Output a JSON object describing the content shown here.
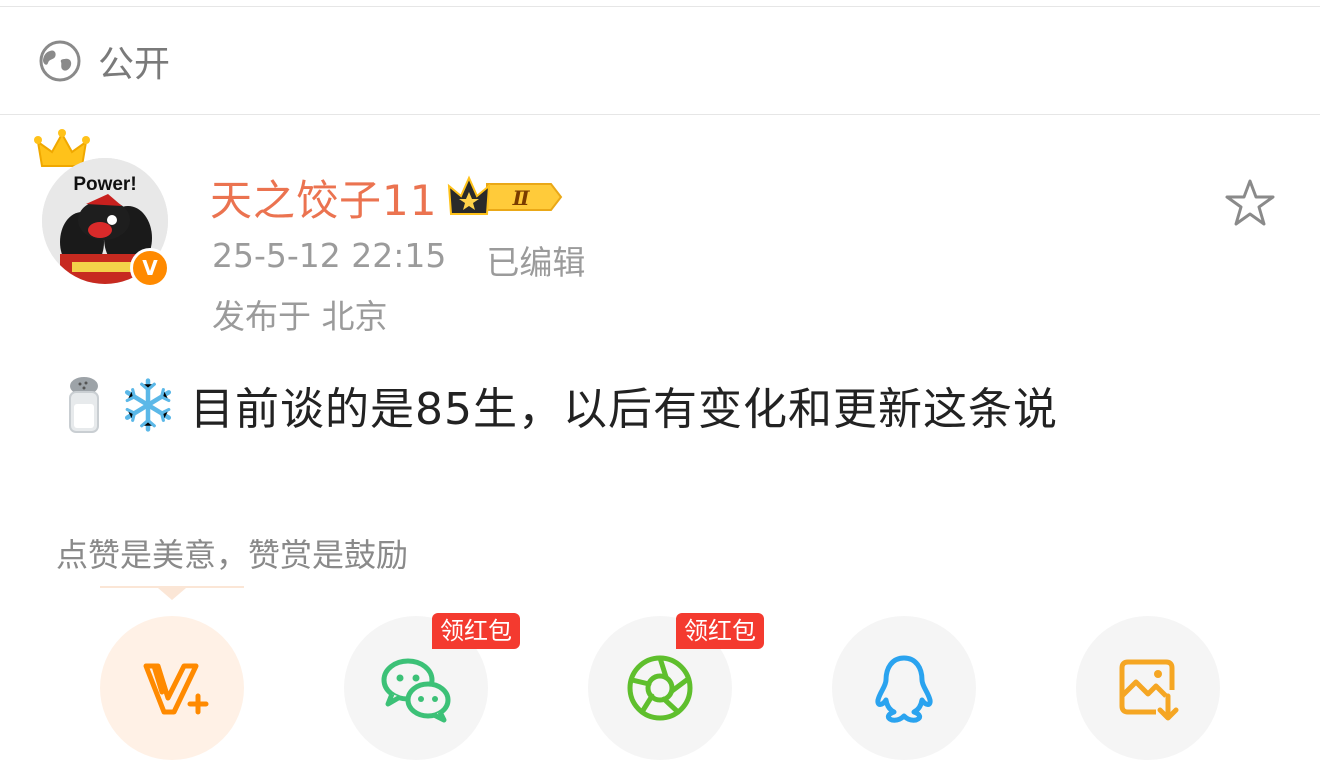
{
  "visibility": {
    "label": "公开",
    "icon": "globe-icon"
  },
  "author": {
    "name": "天之饺子11",
    "avatar_text": "Power!",
    "verified_badge": "V",
    "member_level": "Ⅱ",
    "name_color": "#eb7350"
  },
  "post": {
    "timestamp": "25-5-12 22:15",
    "edited_label": "已编辑",
    "location": "发布于 北京",
    "emojis": [
      "salt-shaker-emoji",
      "snowflake-emoji"
    ],
    "text": "目前谈的是85生，以后有变化和更新这条说"
  },
  "reward": {
    "text": "点赞是美意，赞赏是鼓励"
  },
  "share": {
    "items": [
      {
        "icon": "vplus-icon",
        "color": "#ff8a00",
        "tag": ""
      },
      {
        "icon": "wechat-icon",
        "color": "#3cc177",
        "tag": "领红包"
      },
      {
        "icon": "moments-icon",
        "color": "#5fbf2d",
        "tag": "领红包"
      },
      {
        "icon": "qq-icon",
        "color": "#2aa3ef",
        "tag": ""
      },
      {
        "icon": "save-image-icon",
        "color": "#f5a623",
        "tag": ""
      }
    ]
  }
}
